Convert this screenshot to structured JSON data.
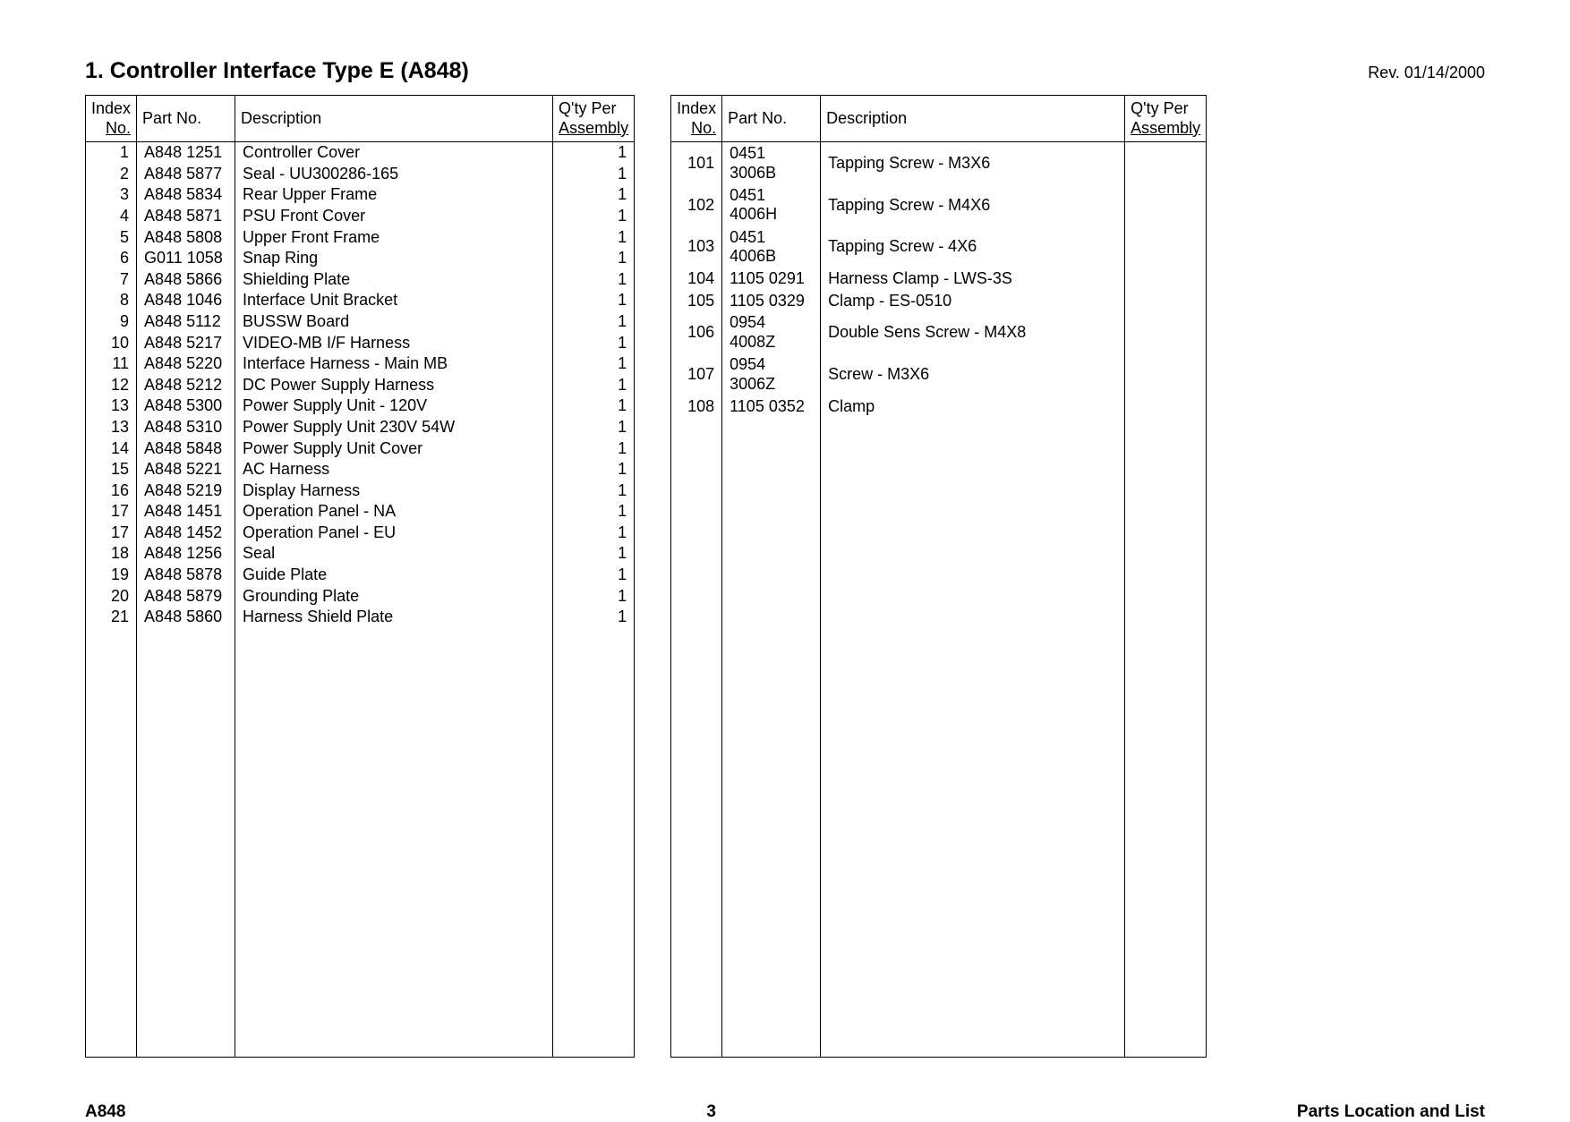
{
  "header": {
    "title": "1. Controller Interface Type E (A848)",
    "revision": "Rev. 01/14/2000"
  },
  "columns": {
    "index": "Index",
    "no": "No.",
    "part": "Part No.",
    "description": "Description",
    "qty_line1": "Q'ty Per",
    "qty_line2": "Assembly"
  },
  "table1": [
    {
      "index": "1",
      "part": "A848 1251",
      "desc": "Controller Cover",
      "qty": "1"
    },
    {
      "index": "2",
      "part": "A848 5877",
      "desc": "Seal - UU300286-165",
      "qty": "1"
    },
    {
      "index": "3",
      "part": "A848 5834",
      "desc": "Rear Upper Frame",
      "qty": "1"
    },
    {
      "index": "4",
      "part": "A848 5871",
      "desc": "PSU Front Cover",
      "qty": "1"
    },
    {
      "index": "5",
      "part": "A848 5808",
      "desc": "Upper Front Frame",
      "qty": "1"
    },
    {
      "index": "6",
      "part": "G011 1058",
      "desc": "Snap Ring",
      "qty": "1"
    },
    {
      "index": "7",
      "part": "A848 5866",
      "desc": "Shielding Plate",
      "qty": "1"
    },
    {
      "index": "8",
      "part": "A848 1046",
      "desc": "Interface Unit Bracket",
      "qty": "1"
    },
    {
      "index": "9",
      "part": "A848 5112",
      "desc": "BUSSW Board",
      "qty": "1"
    },
    {
      "index": "10",
      "part": "A848 5217",
      "desc": "VIDEO-MB I/F Harness",
      "qty": "1"
    },
    {
      "index": "11",
      "part": "A848 5220",
      "desc": "Interface Harness - Main MB",
      "qty": "1"
    },
    {
      "index": "12",
      "part": "A848 5212",
      "desc": "DC Power Supply Harness",
      "qty": "1"
    },
    {
      "index": "13",
      "part": "A848 5300",
      "desc": "Power Supply Unit - 120V",
      "qty": "1"
    },
    {
      "index": "13",
      "part": "A848 5310",
      "desc": "Power Supply Unit 230V 54W",
      "qty": "1"
    },
    {
      "index": "14",
      "part": "A848 5848",
      "desc": "Power Supply Unit Cover",
      "qty": "1"
    },
    {
      "index": "15",
      "part": "A848 5221",
      "desc": "AC Harness",
      "qty": "1"
    },
    {
      "index": "16",
      "part": "A848 5219",
      "desc": "Display Harness",
      "qty": "1"
    },
    {
      "index": "17",
      "part": "A848 1451",
      "desc": "Operation Panel - NA",
      "qty": "1"
    },
    {
      "index": "17",
      "part": "A848 1452",
      "desc": "Operation Panel - EU",
      "qty": "1"
    },
    {
      "index": "18",
      "part": "A848 1256",
      "desc": "Seal",
      "qty": "1"
    },
    {
      "index": "19",
      "part": "A848 5878",
      "desc": "Guide Plate",
      "qty": "1"
    },
    {
      "index": "20",
      "part": "A848 5879",
      "desc": "Grounding Plate",
      "qty": "1"
    },
    {
      "index": "21",
      "part": "A848 5860",
      "desc": "Harness Shield Plate",
      "qty": "1"
    }
  ],
  "table2": [
    {
      "index": "101",
      "part": "0451 3006B",
      "desc": "Tapping Screw - M3X6",
      "qty": ""
    },
    {
      "index": "102",
      "part": "0451 4006H",
      "desc": "Tapping Screw - M4X6",
      "qty": ""
    },
    {
      "index": "103",
      "part": "0451 4006B",
      "desc": "Tapping Screw - 4X6",
      "qty": ""
    },
    {
      "index": "104",
      "part": "1105 0291",
      "desc": "Harness Clamp - LWS-3S",
      "qty": ""
    },
    {
      "index": "105",
      "part": "1105 0329",
      "desc": "Clamp - ES-0510",
      "qty": ""
    },
    {
      "index": "106",
      "part": "0954 4008Z",
      "desc": "Double Sens Screw - M4X8",
      "qty": ""
    },
    {
      "index": "107",
      "part": "0954 3006Z",
      "desc": "Screw - M3X6",
      "qty": ""
    },
    {
      "index": "108",
      "part": "1105 0352",
      "desc": "Clamp",
      "qty": ""
    }
  ],
  "footer": {
    "left": "A848",
    "center": "3",
    "right": "Parts Location and List"
  }
}
